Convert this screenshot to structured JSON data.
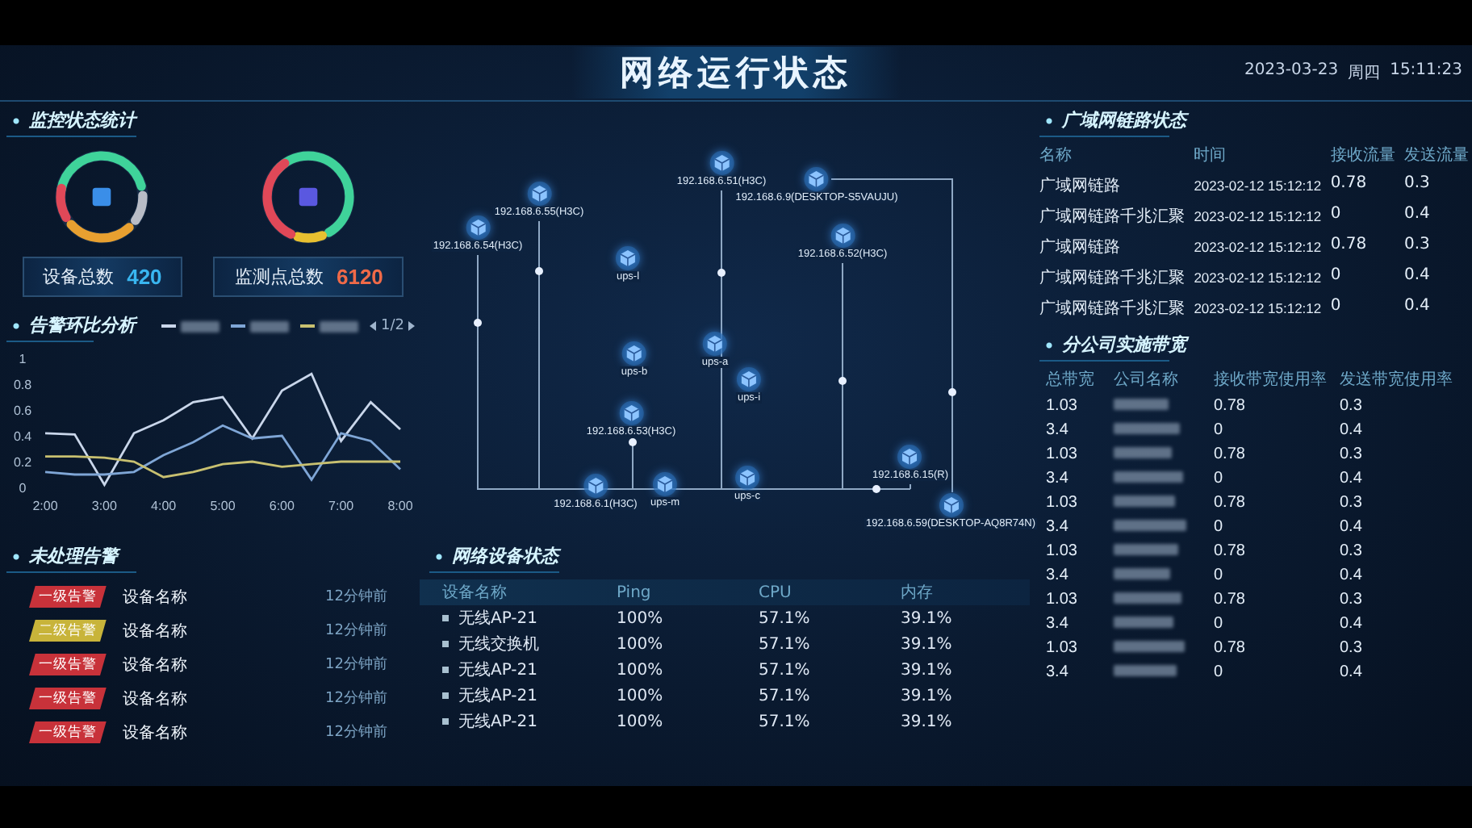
{
  "header": {
    "title": "网络运行状态",
    "date": "2023-03-23",
    "weekday": "周四",
    "time": "15:11:23"
  },
  "monitor_stats": {
    "title": "监控状态统计",
    "items": [
      {
        "label": "设备总数",
        "value": "420",
        "color": "#39b6f0"
      },
      {
        "label": "监测点总数",
        "value": "6120",
        "color": "#f06a48"
      }
    ]
  },
  "alarm_trend": {
    "title": "告警环比分析",
    "pager": "1/2",
    "chart_data": {
      "type": "line",
      "x": [
        2,
        2.5,
        3,
        3.5,
        4,
        4.5,
        5,
        5.5,
        6,
        6.5,
        7,
        7.5,
        8
      ],
      "xlim": [
        2,
        8
      ],
      "ylim": [
        0,
        1
      ],
      "xticks": [
        {
          "value": 2,
          "label": "2:00"
        },
        {
          "value": 3,
          "label": "3:00"
        },
        {
          "value": 4,
          "label": "4:00"
        },
        {
          "value": 5,
          "label": "5:00"
        },
        {
          "value": 6,
          "label": "6:00"
        },
        {
          "value": 7,
          "label": "7:00"
        },
        {
          "value": 8,
          "label": "8:00"
        }
      ],
      "yticks": [
        0,
        0.2,
        0.4,
        0.6,
        0.8,
        1
      ],
      "series": [
        {
          "color": "#c9d6ea",
          "values": [
            0.42,
            0.41,
            0.02,
            0.42,
            0.52,
            0.66,
            0.7,
            0.38,
            0.75,
            0.88,
            0.36,
            0.66,
            0.45
          ]
        },
        {
          "color": "#7fa6d6",
          "values": [
            0.12,
            0.1,
            0.1,
            0.12,
            0.25,
            0.35,
            0.48,
            0.38,
            0.4,
            0.06,
            0.42,
            0.36,
            0.14
          ]
        },
        {
          "color": "#c8c070",
          "values": [
            0.24,
            0.24,
            0.23,
            0.2,
            0.08,
            0.12,
            0.18,
            0.2,
            0.16,
            0.18,
            0.2,
            0.2,
            0.2
          ]
        }
      ]
    }
  },
  "unhandled_alarms": {
    "title": "未处理告警",
    "rows": [
      {
        "level": "一级告警",
        "color": "#c8323a",
        "device": "设备名称",
        "time": "12分钟前"
      },
      {
        "level": "二级告警",
        "color": "#c8b43a",
        "device": "设备名称",
        "time": "12分钟前"
      },
      {
        "level": "一级告警",
        "color": "#c8323a",
        "device": "设备名称",
        "time": "12分钟前"
      },
      {
        "level": "一级告警",
        "color": "#c8323a",
        "device": "设备名称",
        "time": "12分钟前"
      },
      {
        "level": "一级告警",
        "color": "#c8323a",
        "device": "设备名称",
        "time": "12分钟前"
      }
    ]
  },
  "topology": {
    "nodes": [
      {
        "label": "192.168.6.54(H3C)"
      },
      {
        "label": "192.168.6.55(H3C)"
      },
      {
        "label": "192.168.6.51(H3C)"
      },
      {
        "label": "192.168.6.9(DESKTOP-S5VAUJU)"
      },
      {
        "label": "192.168.6.52(H3C)"
      },
      {
        "label": "ups-l"
      },
      {
        "label": "ups-b"
      },
      {
        "label": "ups-a"
      },
      {
        "label": "ups-i"
      },
      {
        "label": "192.168.6.53(H3C)"
      },
      {
        "label": "192.168.6.1(H3C)"
      },
      {
        "label": "ups-m"
      },
      {
        "label": "ups-c"
      },
      {
        "label": "192.168.6.15(R)"
      },
      {
        "label": "192.168.6.59(DESKTOP-AQ8R74N)"
      }
    ]
  },
  "device_status": {
    "title": "网络设备状态",
    "columns": [
      "设备名称",
      "Ping",
      "CPU",
      "内存"
    ],
    "rows": [
      {
        "name": "无线AP-21",
        "ping": "100%",
        "cpu": "57.1%",
        "memory": "39.1%"
      },
      {
        "name": "无线交换机",
        "ping": "100%",
        "cpu": "57.1%",
        "memory": "39.1%"
      },
      {
        "name": "无线AP-21",
        "ping": "100%",
        "cpu": "57.1%",
        "memory": "39.1%"
      },
      {
        "name": "无线AP-21",
        "ping": "100%",
        "cpu": "57.1%",
        "memory": "39.1%"
      },
      {
        "name": "无线AP-21",
        "ping": "100%",
        "cpu": "57.1%",
        "memory": "39.1%"
      }
    ]
  },
  "wan_links": {
    "title": "广域网链路状态",
    "columns": [
      "名称",
      "时间",
      "接收流量",
      "发送流量"
    ],
    "rows": [
      {
        "name": "广域网链路",
        "time": "2023-02-12 15:12:12",
        "received": "0.78",
        "sent": "0.3"
      },
      {
        "name": "广域网链路千兆汇聚",
        "time": "2023-02-12 15:12:12",
        "received": "0",
        "sent": "0.4"
      },
      {
        "name": "广域网链路",
        "time": "2023-02-12 15:12:12",
        "received": "0.78",
        "sent": "0.3"
      },
      {
        "name": "广域网链路千兆汇聚",
        "time": "2023-02-12 15:12:12",
        "received": "0",
        "sent": "0.4"
      },
      {
        "name": "广域网链路千兆汇聚",
        "time": "2023-02-12 15:12:12",
        "received": "0",
        "sent": "0.4"
      }
    ]
  },
  "branch_bandwidth": {
    "title": "分公司实施带宽",
    "columns": [
      "总带宽",
      "公司名称",
      "接收带宽使用率",
      "发送带宽使用率"
    ],
    "rows": [
      {
        "total": "1.03",
        "received": "0.78",
        "sent": "0.3"
      },
      {
        "total": "3.4",
        "received": "0",
        "sent": "0.4"
      },
      {
        "total": "1.03",
        "received": "0.78",
        "sent": "0.3"
      },
      {
        "total": "3.4",
        "received": "0",
        "sent": "0.4"
      },
      {
        "total": "1.03",
        "received": "0.78",
        "sent": "0.3"
      },
      {
        "total": "3.4",
        "received": "0",
        "sent": "0.4"
      },
      {
        "total": "1.03",
        "received": "0.78",
        "sent": "0.3"
      },
      {
        "total": "3.4",
        "received": "0",
        "sent": "0.4"
      },
      {
        "total": "1.03",
        "received": "0.78",
        "sent": "0.3"
      },
      {
        "total": "3.4",
        "received": "0",
        "sent": "0.4"
      },
      {
        "total": "1.03",
        "received": "0.78",
        "sent": "0.3"
      },
      {
        "total": "3.4",
        "received": "0",
        "sent": "0.4"
      }
    ]
  }
}
